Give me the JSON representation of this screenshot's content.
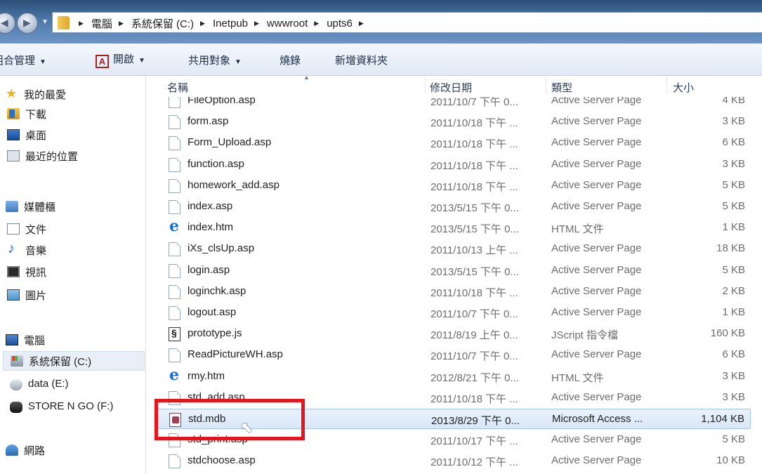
{
  "address": {
    "crumbs": [
      "電腦",
      "系統保留 (C:)",
      "Inetpub",
      "wwwroot",
      "upts6"
    ]
  },
  "toolbar": {
    "organize": "組合管理",
    "open": "開啟",
    "share": "共用對象",
    "burn": "燒錄",
    "new_folder": "新增資料夾"
  },
  "sidebar": {
    "favorites": "我的最愛",
    "downloads": "下載",
    "desktop": "桌面",
    "recent": "最近的位置",
    "libraries": "媒體櫃",
    "documents": "文件",
    "music": "音樂",
    "videos": "視訊",
    "pictures": "圖片",
    "computer": "電腦",
    "drive_c": "系統保留 (C:)",
    "drive_e": "data (E:)",
    "drive_f": "STORE N GO (F:)",
    "network": "網路"
  },
  "columns": {
    "name": "名稱",
    "date": "修改日期",
    "type": "類型",
    "size": "大小"
  },
  "files": [
    {
      "name": "FileOption.asp",
      "date": "2011/10/7 下午 0...",
      "type": "Active Server Page",
      "size": "4 KB",
      "icon": "page-icon"
    },
    {
      "name": "form.asp",
      "date": "2011/10/18 下午 ...",
      "type": "Active Server Page",
      "size": "3 KB",
      "icon": "page-icon"
    },
    {
      "name": "Form_Upload.asp",
      "date": "2011/10/18 下午 ...",
      "type": "Active Server Page",
      "size": "6 KB",
      "icon": "page-icon"
    },
    {
      "name": "function.asp",
      "date": "2011/10/18 下午 ...",
      "type": "Active Server Page",
      "size": "3 KB",
      "icon": "page-icon"
    },
    {
      "name": "homework_add.asp",
      "date": "2011/10/18 下午 ...",
      "type": "Active Server Page",
      "size": "5 KB",
      "icon": "page-icon"
    },
    {
      "name": "index.asp",
      "date": "2013/5/15 下午 0...",
      "type": "Active Server Page",
      "size": "5 KB",
      "icon": "page-icon"
    },
    {
      "name": "index.htm",
      "date": "2013/5/15 下午 0...",
      "type": "HTML 文件",
      "size": "1 KB",
      "icon": "ie-icon"
    },
    {
      "name": "iXs_clsUp.asp",
      "date": "2011/10/13 上午 ...",
      "type": "Active Server Page",
      "size": "18 KB",
      "icon": "page-icon"
    },
    {
      "name": "login.asp",
      "date": "2013/5/15 下午 0...",
      "type": "Active Server Page",
      "size": "5 KB",
      "icon": "page-icon"
    },
    {
      "name": "loginchk.asp",
      "date": "2011/10/18 下午 ...",
      "type": "Active Server Page",
      "size": "2 KB",
      "icon": "page-icon"
    },
    {
      "name": "logout.asp",
      "date": "2011/10/7 下午 0...",
      "type": "Active Server Page",
      "size": "1 KB",
      "icon": "page-icon"
    },
    {
      "name": "prototype.js",
      "date": "2011/8/19 上午 0...",
      "type": "JScript 指令檔",
      "size": "160 KB",
      "icon": "js-icon"
    },
    {
      "name": "ReadPictureWH.asp",
      "date": "2011/10/7 下午 0...",
      "type": "Active Server Page",
      "size": "6 KB",
      "icon": "page-icon"
    },
    {
      "name": "rmy.htm",
      "date": "2012/8/21 下午 0...",
      "type": "HTML 文件",
      "size": "3 KB",
      "icon": "ie-icon"
    },
    {
      "name": "std_add.asp",
      "date": "2011/10/18 下午 ...",
      "type": "Active Server Page",
      "size": "3 KB",
      "icon": "page-icon"
    },
    {
      "name": "std.mdb",
      "date": "2013/8/29 下午 0...",
      "type": "Microsoft Access ...",
      "size": "1,104 KB",
      "icon": "mdb-icon"
    },
    {
      "name": "std_print.asp",
      "date": "2011/10/17 下午 ...",
      "type": "Active Server Page",
      "size": "5 KB",
      "icon": "page-icon"
    },
    {
      "name": "stdchoose.asp",
      "date": "2011/10/12 下午 ...",
      "type": "Active Server Page",
      "size": "10 KB",
      "icon": "page-icon"
    }
  ],
  "selected_file": "std.mdb",
  "colors": {
    "highlight_box": "#e8141c",
    "selection": "#d9e7f8"
  }
}
